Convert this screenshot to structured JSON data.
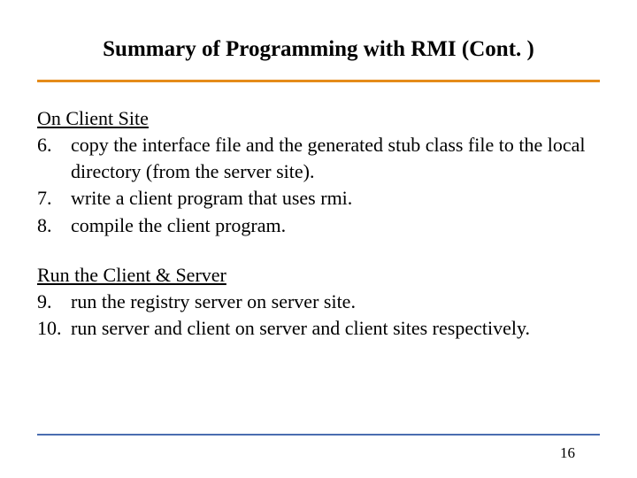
{
  "title": "Summary of Programming with RMI (Cont. )",
  "section1": {
    "heading": "On Client Site",
    "items": [
      {
        "num": "6.",
        "text": "copy the interface file and the generated stub class file to the local directory (from the server site)."
      },
      {
        "num": "7.",
        "text": "write a client program that uses rmi."
      },
      {
        "num": "8.",
        "text": "compile the client program."
      }
    ]
  },
  "section2": {
    "heading": "Run the Client & Server",
    "items": [
      {
        "num": "9.",
        "text": "run the registry server on server site."
      },
      {
        "num": "10.",
        "text": "run server and client on server and client sites respectively."
      }
    ]
  },
  "page_number": "16"
}
